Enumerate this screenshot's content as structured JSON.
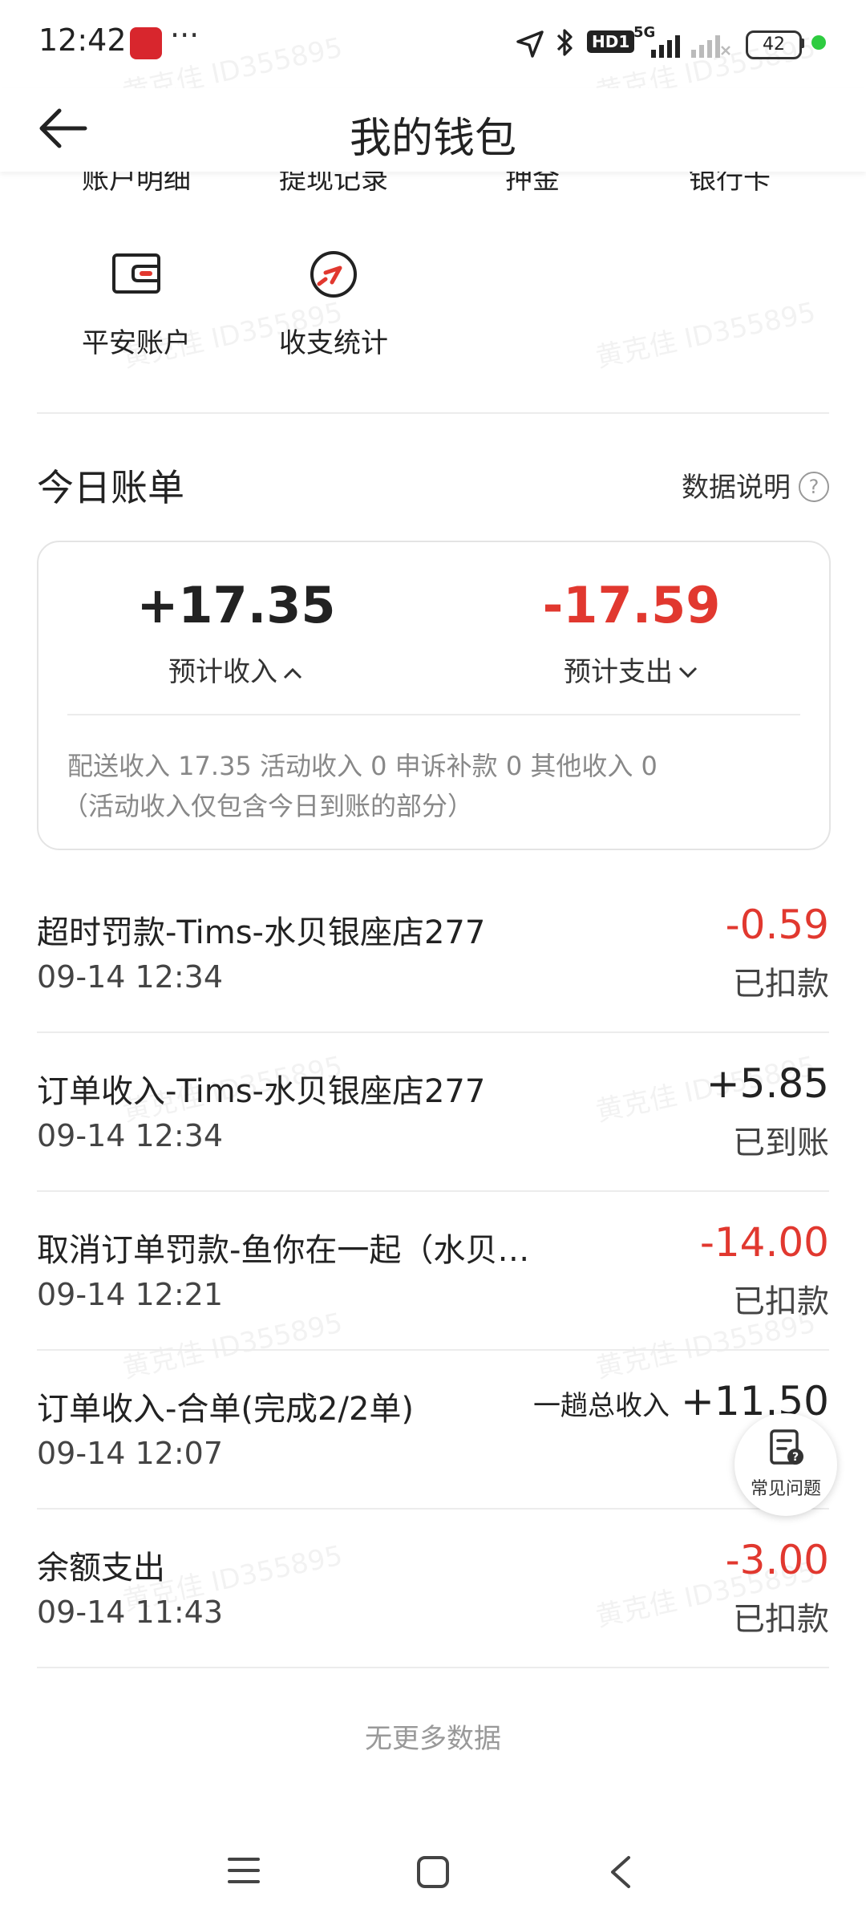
{
  "status_bar": {
    "time": "12:42",
    "dots": "···",
    "hd_badge": "HD1",
    "network": "5G",
    "battery": "42"
  },
  "header": {
    "title": "我的钱包"
  },
  "quick_menu": {
    "row1": [
      "账户明细",
      "提现记录",
      "押金",
      "银行卡"
    ],
    "row2": [
      {
        "label": "平安账户",
        "icon": "wallet-icon"
      },
      {
        "label": "收支统计",
        "icon": "stats-icon"
      }
    ]
  },
  "today_bill": {
    "title": "今日账单",
    "data_note": "数据说明",
    "help": "?",
    "income_value": "+17.35",
    "income_label": "预计收入",
    "expense_value": "-17.59",
    "expense_label": "预计支出",
    "detail_line1": "配送收入 17.35 活动收入 0 申诉补款 0 其他收入 0",
    "detail_line2": "（活动收入仅包含今日到账的部分）"
  },
  "transactions": [
    {
      "title": "超时罚款-Tims-水贝银座店277",
      "time": "09-14 12:34",
      "amount": "-0.59",
      "status": "已扣款",
      "type": "neg"
    },
    {
      "title": "订单收入-Tims-水贝银座店277",
      "time": "09-14 12:34",
      "amount": "+5.85",
      "status": "已到账",
      "type": "pos"
    },
    {
      "title": "取消订单罚款-鱼你在一起（水贝…",
      "time": "09-14 12:21",
      "amount": "-14.00",
      "status": "已扣款",
      "type": "neg"
    },
    {
      "title": "订单收入-合单(完成2/2单)",
      "time": "09-14 12:07",
      "amount": "+11.50",
      "amount_prefix": "一趟总收入",
      "status": "",
      "type": "pos"
    },
    {
      "title": "余额支出",
      "time": "09-14 11:43",
      "amount": "-3.00",
      "status": "已扣款",
      "type": "neg"
    }
  ],
  "no_more": "无更多数据",
  "faq": {
    "label": "常见问题",
    "icon": "faq-icon"
  },
  "watermark": "黄克佳 ID355895",
  "colors": {
    "accent_red": "#e1382f",
    "text": "#222222"
  }
}
